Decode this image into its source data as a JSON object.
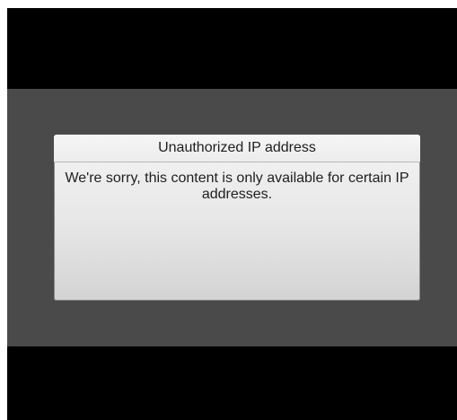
{
  "dialog": {
    "title": "Unauthorized IP address",
    "message": "We're sorry, this content is only available for certain IP addresses."
  },
  "colors": {
    "letterbox": "#000000",
    "stage": "#4a4a4a",
    "dialog_background": "#e6e6e6",
    "text": "#1e1e1e"
  }
}
